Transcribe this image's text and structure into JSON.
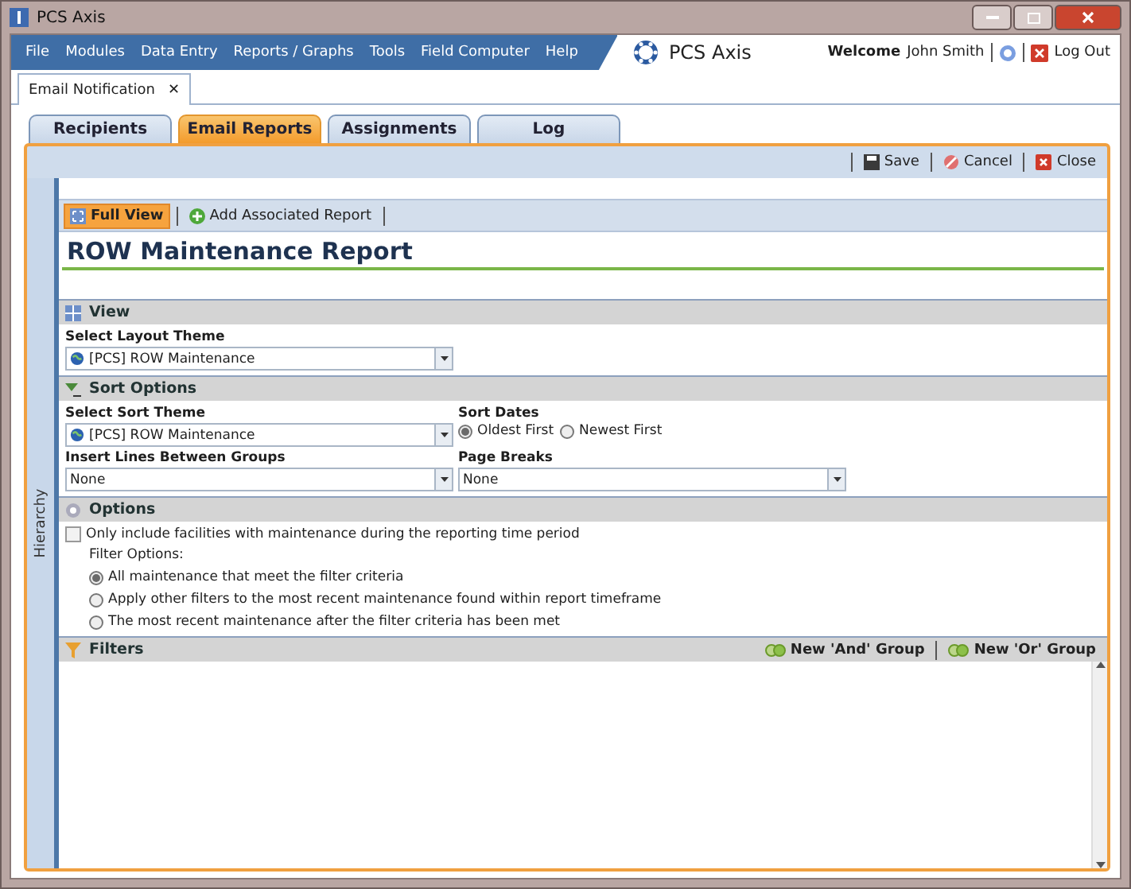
{
  "window": {
    "title": "PCS Axis"
  },
  "menu": [
    "File",
    "Modules",
    "Data Entry",
    "Reports / Graphs",
    "Tools",
    "Field Computer",
    "Help"
  ],
  "brand": "PCS Axis",
  "user": {
    "welcome": "Welcome",
    "name": "John Smith",
    "logout": "Log Out"
  },
  "doc_tab": {
    "label": "Email Notification",
    "close": "✕"
  },
  "tabs": [
    {
      "label": "Recipients",
      "selected": false
    },
    {
      "label": "Email Reports",
      "selected": true
    },
    {
      "label": "Assignments",
      "selected": false
    },
    {
      "label": "Log",
      "selected": false
    }
  ],
  "toolbar": [
    {
      "kind": "save",
      "label": "Save"
    },
    {
      "kind": "cancel",
      "label": "Cancel"
    },
    {
      "kind": "close",
      "label": "Close"
    }
  ],
  "side_panel": {
    "label": "Hierarchy"
  },
  "subtoolbar": [
    {
      "kind": "fullview",
      "label": "Full View",
      "selected": true
    },
    {
      "kind": "add",
      "label": "Add Associated Report",
      "selected": false
    }
  ],
  "report_title": "ROW Maintenance Report",
  "view": {
    "title": "View",
    "layout_label": "Select Layout Theme",
    "layout_value": "[PCS] ROW Maintenance"
  },
  "sort": {
    "title": "Sort Options",
    "theme_label": "Select Sort Theme",
    "theme_value": "[PCS] ROW Maintenance",
    "dates_label": "Sort Dates",
    "dates": [
      {
        "label": "Oldest First",
        "selected": true
      },
      {
        "label": "Newest First",
        "selected": false
      }
    ],
    "lines_label": "Insert Lines Between Groups",
    "lines_value": "None",
    "breaks_label": "Page Breaks",
    "breaks_value": "None"
  },
  "options": {
    "title": "Options",
    "only_include": {
      "label": "Only include facilities with maintenance during the reporting time period",
      "checked": false
    },
    "filter_label": "Filter Options:",
    "filter_options": [
      {
        "label": "All maintenance that meet the filter criteria",
        "selected": true
      },
      {
        "label": "Apply other filters to the most recent maintenance found within report timeframe",
        "selected": false
      },
      {
        "label": "The most recent maintenance after the filter criteria has been met",
        "selected": false
      }
    ]
  },
  "filters": {
    "title": "Filters",
    "actions": [
      "New 'And' Group",
      "New 'Or' Group"
    ]
  }
}
